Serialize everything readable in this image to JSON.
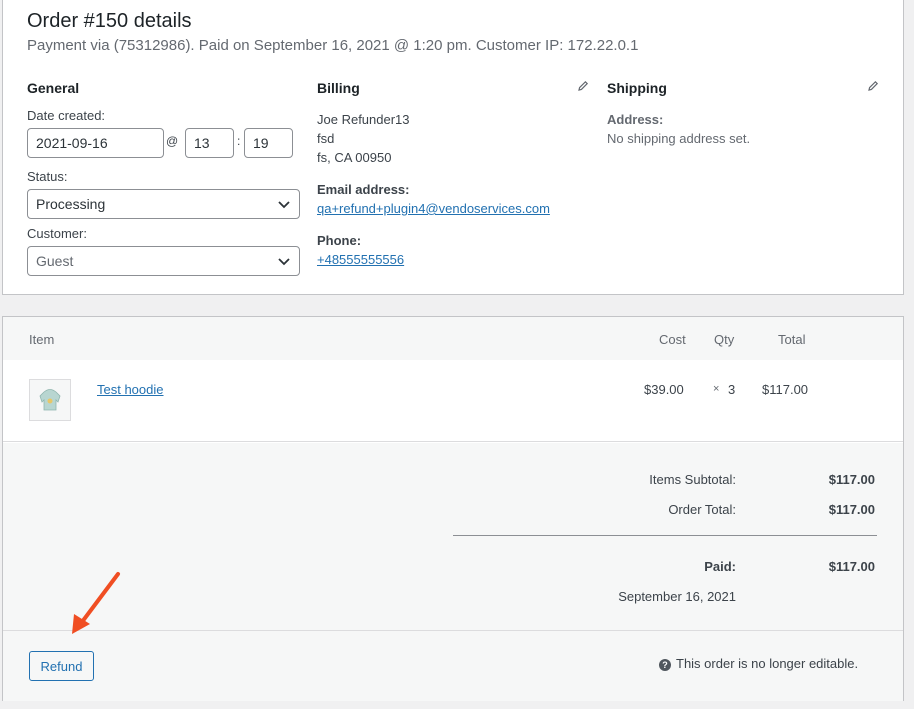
{
  "header": {
    "title": "Order #150 details",
    "subtitle": "Payment via (75312986). Paid on September 16, 2021 @ 1:20 pm. Customer IP: 172.22.0.1"
  },
  "general": {
    "heading": "General",
    "date_label": "Date created:",
    "date_value": "2021-09-16",
    "at": "@",
    "hour": "13",
    "colon": ":",
    "minute": "19",
    "status_label": "Status:",
    "status_value": "Processing",
    "customer_label": "Customer:",
    "customer_value": "Guest"
  },
  "billing": {
    "heading": "Billing",
    "name": "Joe Refunder13",
    "line2": "fsd",
    "city": "fs, CA 00950",
    "email_label": "Email address:",
    "email": "qa+refund+plugin4@vendoservices.com",
    "phone_label": "Phone:",
    "phone": "+48555555556"
  },
  "shipping": {
    "heading": "Shipping",
    "address_label": "Address:",
    "address_value": "No shipping address set."
  },
  "items": {
    "headers": {
      "item": "Item",
      "cost": "Cost",
      "qty": "Qty",
      "total": "Total"
    },
    "rows": [
      {
        "name": "Test hoodie",
        "cost": "$39.00",
        "qty_x": "×",
        "qty": "3",
        "total": "$117.00"
      }
    ]
  },
  "totals": {
    "subtotal_label": "Items Subtotal:",
    "subtotal_value": "$117.00",
    "order_total_label": "Order Total:",
    "order_total_value": "$117.00",
    "paid_label": "Paid:",
    "paid_value": "$117.00",
    "paid_date": "September 16, 2021"
  },
  "footer": {
    "refund_label": "Refund",
    "help_glyph": "?",
    "not_editable": "This order is no longer editable."
  },
  "colors": {
    "link": "#2271b1",
    "annotation_arrow": "#f04e23"
  },
  "icons": [
    "pencil-icon",
    "chevron-down-icon",
    "help-icon",
    "hoodie-thumbnail",
    "annotation-arrow"
  ]
}
